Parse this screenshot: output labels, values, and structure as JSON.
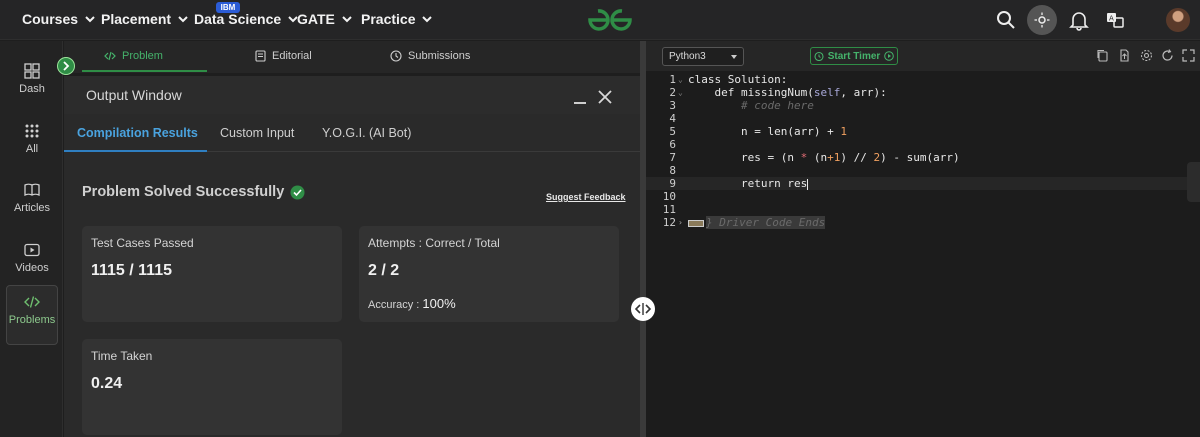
{
  "nav": {
    "items": [
      {
        "label": "Courses"
      },
      {
        "label": "Placement"
      },
      {
        "label": "Data Science",
        "badge": "IBM"
      },
      {
        "label": "GATE"
      },
      {
        "label": "Practice"
      }
    ]
  },
  "rail": {
    "items": [
      {
        "label": "Dash",
        "icon": "grid-icon"
      },
      {
        "label": "All",
        "icon": "dots-grid-icon"
      },
      {
        "label": "Articles",
        "icon": "book-icon"
      },
      {
        "label": "Videos",
        "icon": "play-icon"
      },
      {
        "label": "Problems",
        "icon": "code-icon",
        "active": true
      }
    ]
  },
  "problem_tabs": [
    {
      "label": "Problem",
      "icon": "code-icon",
      "active": true
    },
    {
      "label": "Editorial",
      "icon": "document-icon"
    },
    {
      "label": "Submissions",
      "icon": "clock-icon"
    }
  ],
  "output": {
    "title": "Output Window",
    "tabs": [
      {
        "label": "Compilation Results",
        "active": true
      },
      {
        "label": "Custom Input"
      },
      {
        "label": "Y.O.G.I. (AI Bot)"
      }
    ],
    "status": "Problem Solved Successfully",
    "feedback_link": "Suggest Feedback",
    "cards": {
      "test_cases": {
        "label": "Test Cases Passed",
        "value": "1115 / 1115"
      },
      "attempts": {
        "label": "Attempts : Correct / Total",
        "value": "2 / 2",
        "accuracy_label": "Accuracy :",
        "accuracy_value": "100%"
      },
      "time": {
        "label": "Time Taken",
        "value": "0.24"
      }
    }
  },
  "editor": {
    "language": "Python3",
    "timer_label": "Start Timer",
    "line_numbers": [
      "1",
      "2",
      "3",
      "4",
      "5",
      "6",
      "7",
      "8",
      "9",
      "10",
      "11",
      "12"
    ],
    "code": {
      "l1": "class Solution:",
      "l2a": "    def missingNum(",
      "l2b": "self",
      "l2c": ", arr):",
      "l3": "        # code here",
      "l5a": "        n = len(arr) + ",
      "l5b": "1",
      "l7a": "        res = (n ",
      "l7b": "*",
      "l7c": " (n",
      "l7d": "+1",
      "l7e": ") // ",
      "l7f": "2",
      "l7g": ") - sum(arr)",
      "l9": "        return res",
      "l12": "} Driver Code Ends"
    }
  },
  "colors": {
    "accent_green": "#2f8d46",
    "link_blue": "#4aa3df",
    "background": "#1e1e1e"
  }
}
